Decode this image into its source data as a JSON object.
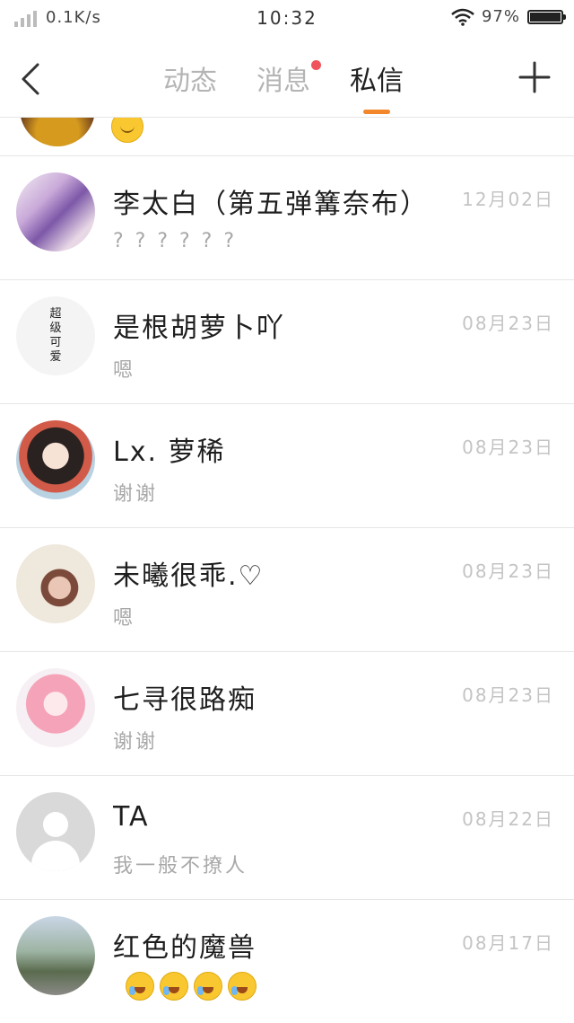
{
  "status_bar": {
    "network_speed": "0.1K/s",
    "time": "10:32",
    "battery_percent": "97%",
    "battery_level": 0.97
  },
  "header": {
    "tabs": [
      {
        "label": "动态",
        "active": false,
        "unread_dot": false
      },
      {
        "label": "消息",
        "active": false,
        "unread_dot": true
      },
      {
        "label": "私信",
        "active": true,
        "unread_dot": false
      }
    ],
    "accent_color": "#f3872c"
  },
  "conversations": [
    {
      "name": "李太白（第五弹篝奈布）",
      "message": "? ? ? ? ? ?",
      "date": "12月02日"
    },
    {
      "name": "是根胡萝卜吖",
      "message": "嗯",
      "date": "08月23日",
      "avatar_text": [
        "超",
        "级",
        "可",
        "爱"
      ]
    },
    {
      "name": "Lx. 萝稀",
      "message": "谢谢",
      "date": "08月23日"
    },
    {
      "name": "未曦很乖.♡",
      "message": "嗯",
      "date": "08月23日"
    },
    {
      "name": "七寻很路痴",
      "message": "谢谢",
      "date": "08月23日"
    },
    {
      "name": "TA",
      "message": "我一般不撩人",
      "date": "08月22日"
    },
    {
      "name": "红色的魔兽",
      "message": "",
      "date": "08月17日",
      "emoji": [
        "face-with-tears-of-joy",
        "face-with-tears-of-joy",
        "face-with-tears-of-joy",
        "face-with-tears-of-joy"
      ]
    }
  ]
}
